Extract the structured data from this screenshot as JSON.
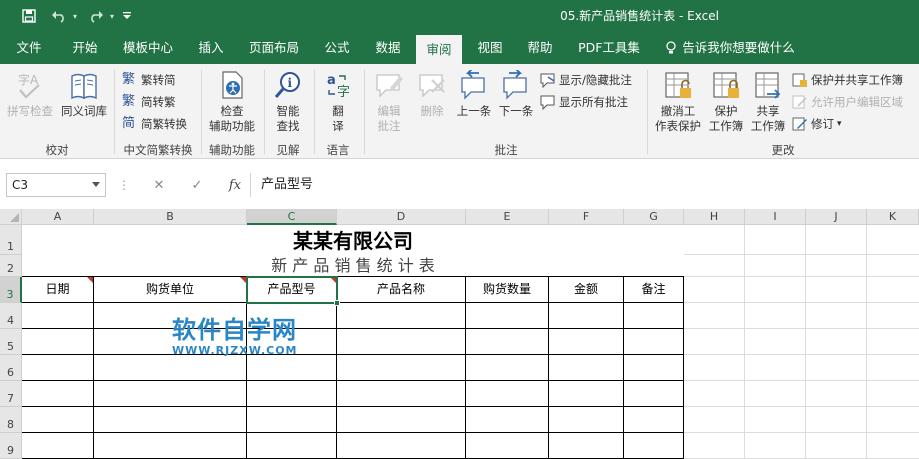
{
  "window": {
    "title": "05.新产品销售统计表  -  Excel"
  },
  "qat": {
    "save": "save-icon",
    "undo": "undo-icon",
    "redo": "redo-icon",
    "customize": "customize-icon"
  },
  "tabs": [
    {
      "label": "文件"
    },
    {
      "label": "开始"
    },
    {
      "label": "模板中心"
    },
    {
      "label": "插入"
    },
    {
      "label": "页面布局"
    },
    {
      "label": "公式"
    },
    {
      "label": "数据"
    },
    {
      "label": "审阅"
    },
    {
      "label": "视图"
    },
    {
      "label": "帮助"
    },
    {
      "label": "PDF工具集"
    },
    {
      "label": "告诉我你想要做什么"
    }
  ],
  "ribbon": {
    "proofing": {
      "spell": "拼写检查",
      "thesaurus": "同义词库",
      "group": "校对"
    },
    "chinese": {
      "t2s": "繁转简",
      "s2t": "简转繁",
      "convert": "简繁转换",
      "group": "中文简繁转换"
    },
    "accessibility": {
      "check_l1": "检查",
      "check_l2": "辅助功能",
      "group": "辅助功能"
    },
    "insights": {
      "smart_l1": "智能",
      "smart_l2": "查找",
      "group": "见解"
    },
    "language": {
      "translate_l1": "翻",
      "translate_l2": "译",
      "group": "语言"
    },
    "comments": {
      "edit_l1": "编辑",
      "edit_l2": "批注",
      "delete": "删除",
      "prev": "上一条",
      "next": "下一条",
      "show_hide": "显示/隐藏批注",
      "show_all": "显示所有批注",
      "group": "批注"
    },
    "changes": {
      "unprotect_l1": "撤消工",
      "unprotect_l2": "作表保护",
      "protect_l1": "保护",
      "protect_l2": "工作簿",
      "share_l1": "共享",
      "share_l2": "工作簿",
      "protect_share": "保护并共享工作簿",
      "allow_edit": "允许用户编辑区域",
      "track": "修订",
      "group": "更改"
    }
  },
  "formula_bar": {
    "name_box": "C3",
    "content": "产品型号",
    "cancel": "✕",
    "enter": "✓",
    "fx": "fx"
  },
  "columns": [
    "A",
    "B",
    "C",
    "D",
    "E",
    "F",
    "G",
    "H",
    "I",
    "J",
    "K"
  ],
  "rows": [
    "1",
    "2",
    "3",
    "4",
    "5",
    "6",
    "7",
    "8",
    "9"
  ],
  "sheet": {
    "title": "某某有限公司",
    "subtitle": "新 产 品 销 售 统 计 表",
    "headers": [
      "日期",
      "购货单位",
      "产品型号",
      "产品名称",
      "购货数量",
      "金额",
      "备注"
    ]
  },
  "watermark": {
    "line1": "软件自学网",
    "line2": "WWW.RJZXW.COM"
  }
}
